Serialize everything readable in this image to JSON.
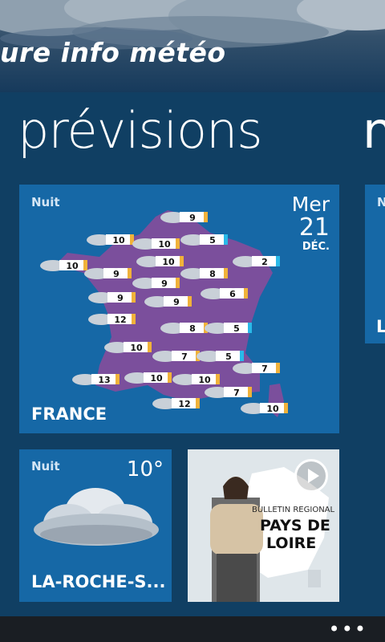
{
  "app": {
    "title": "ure info météo"
  },
  "pivot": {
    "title": "prévisions",
    "next_peek": "n"
  },
  "france_tile": {
    "period": "Nuit",
    "date_day": "Mer",
    "date_num": "21",
    "date_month": "DÉC.",
    "region": "FRANCE",
    "temps": [
      "9",
      "10",
      "10",
      "5",
      "10",
      "2",
      "10",
      "9",
      "9",
      "8",
      "6",
      "9",
      "9",
      "12",
      "8",
      "5",
      "10",
      "7",
      "5",
      "7",
      "13",
      "10",
      "10",
      "7",
      "12",
      "10"
    ]
  },
  "city_tile": {
    "period": "Nuit",
    "temp": "10°",
    "name": "LA-ROCHE-S..."
  },
  "video_tile": {
    "line1": "BULLETIN REGIONAL",
    "line2": "PAYS DE",
    "line3": "LOIRE"
  },
  "side_tile": {
    "label_top": "N",
    "label_bottom": "L"
  },
  "appbar": {
    "more_label": "•••"
  },
  "colors": {
    "background": "#103f63",
    "tile": "#1668a6",
    "map": "#7b4f9c",
    "warm_badge": "#f0b23a",
    "cold_badge": "#29b9e8"
  }
}
